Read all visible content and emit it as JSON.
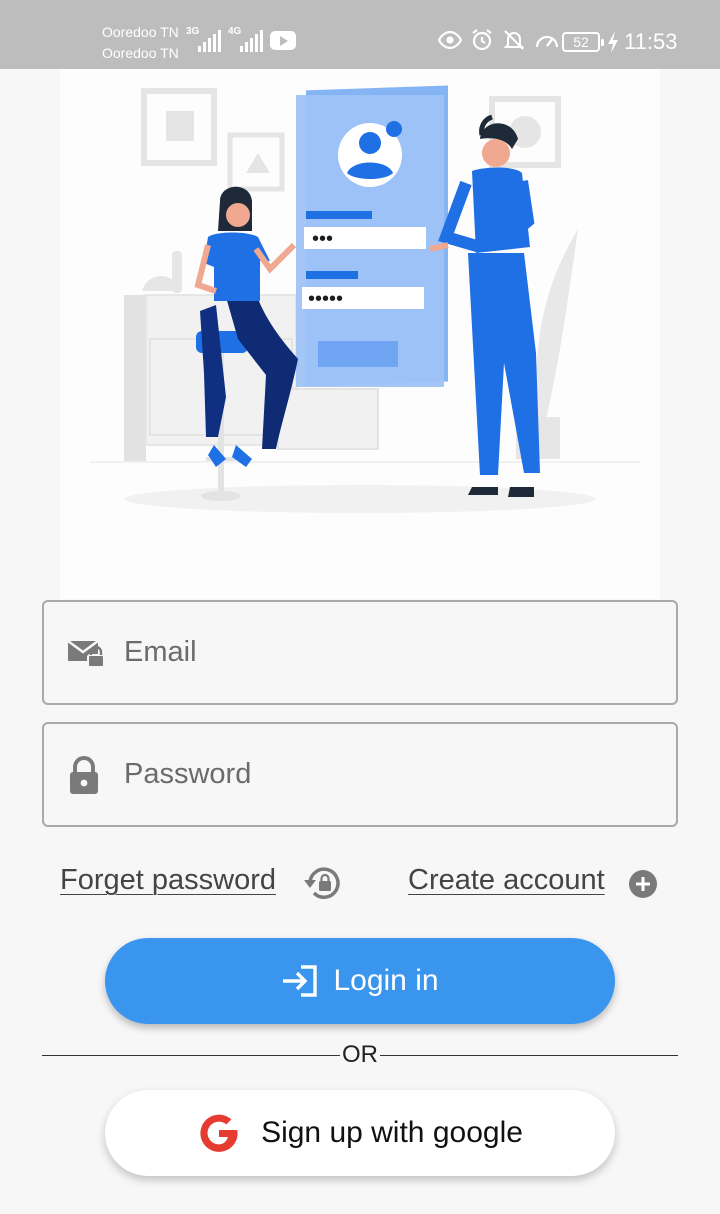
{
  "status_bar": {
    "carrier_1": "Ooredoo TN",
    "carrier_2": "Ooredoo TN",
    "network_1": "3G",
    "network_2": "4G",
    "battery": "52",
    "time": "11:53"
  },
  "illustration": {
    "password_dots_1": "•••",
    "password_dots_2": "•••••"
  },
  "form": {
    "email_placeholder": "Email",
    "password_placeholder": "Password",
    "forgot_label": "Forget password",
    "create_label": "Create account",
    "login_label": "Login in",
    "or_label": "OR",
    "google_label": "Sign up with google"
  },
  "colors": {
    "primary": "#3a95ee",
    "illustration_blue": "#1f6fe5",
    "status_bar": "#bdbdbd"
  },
  "icons": [
    "mail-lock-icon",
    "lock-icon",
    "lock-reset-icon",
    "add-circle-icon",
    "login-icon",
    "google-icon"
  ]
}
